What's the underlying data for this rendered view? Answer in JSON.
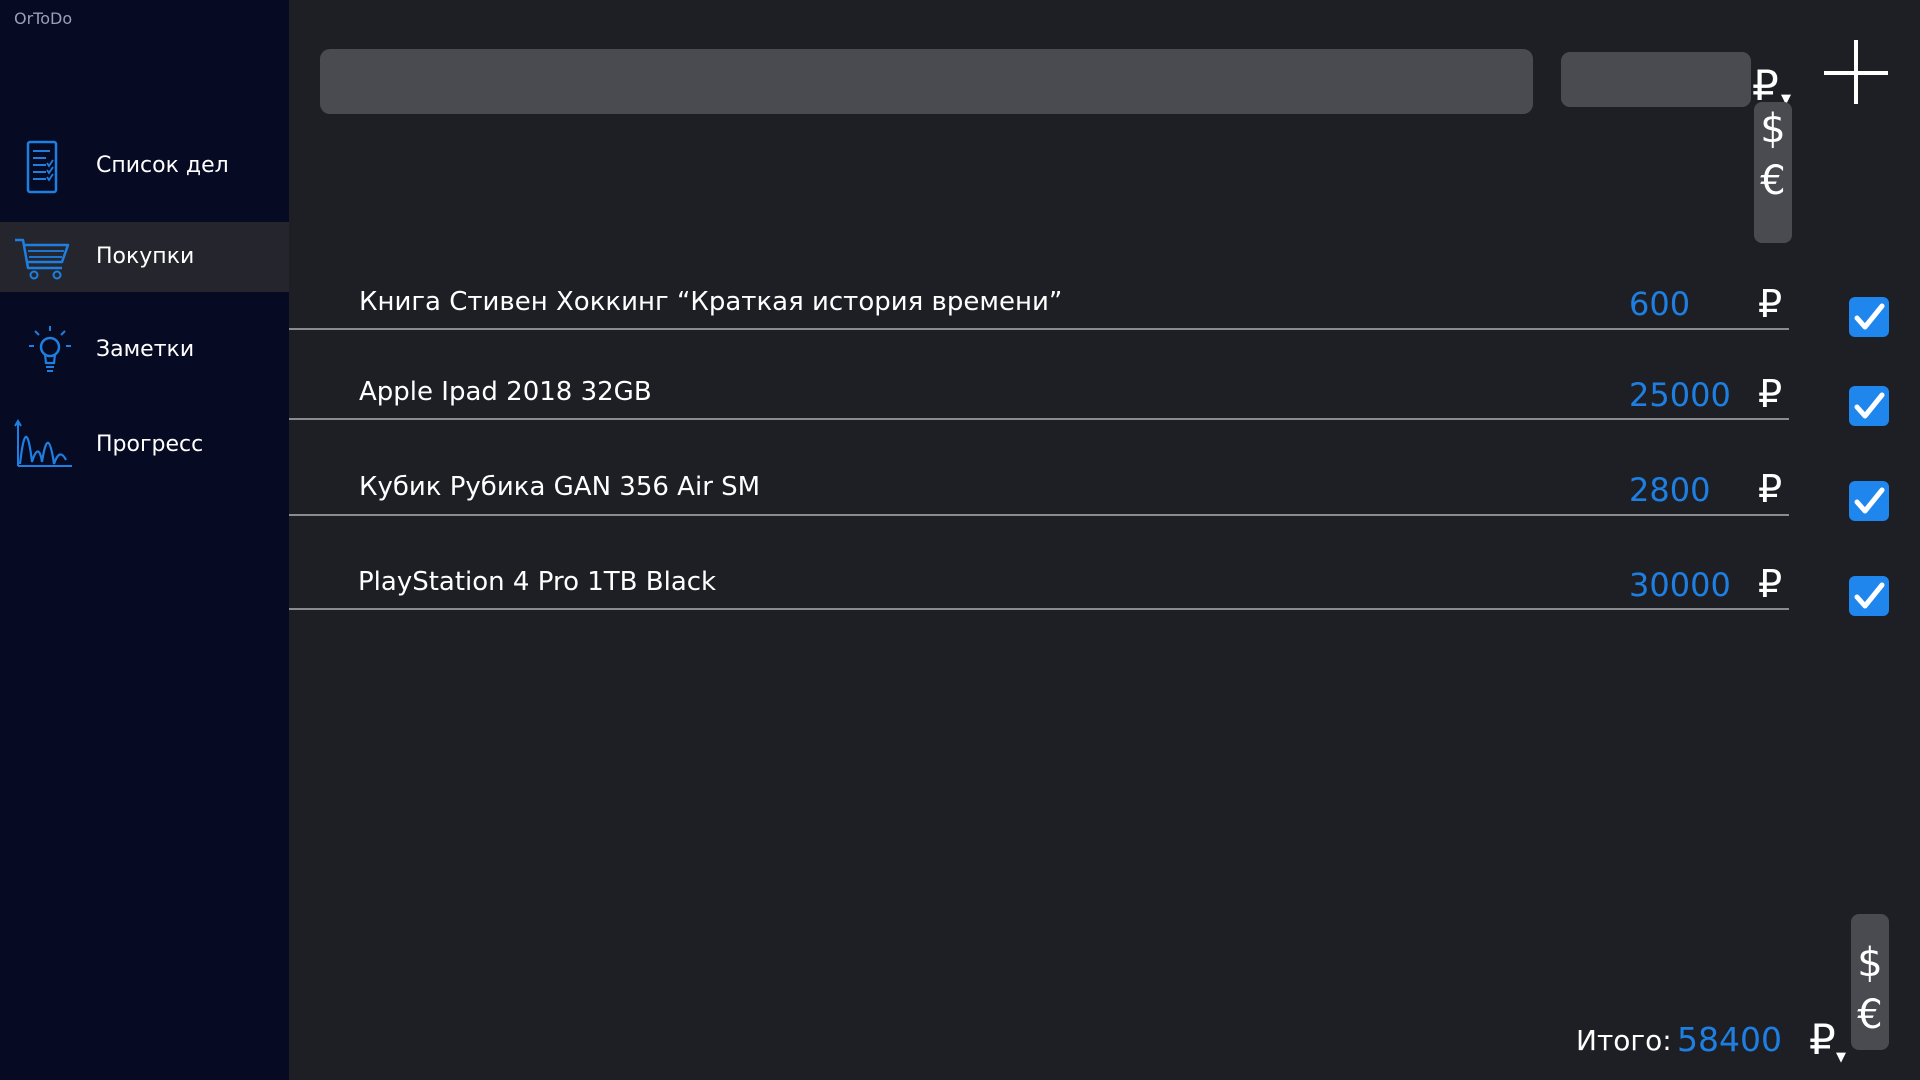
{
  "app": {
    "title": "OrToDo"
  },
  "sidebar": {
    "items": [
      {
        "label": "Список дел",
        "icon": "checklist-icon",
        "active": false
      },
      {
        "label": "Покупки",
        "icon": "cart-icon",
        "active": true
      },
      {
        "label": "Заметки",
        "icon": "lightbulb-icon",
        "active": false
      },
      {
        "label": "Прогресс",
        "icon": "chart-icon",
        "active": false
      }
    ]
  },
  "toolbar": {
    "search_value": "",
    "price_value": "",
    "currency_selected": "₽",
    "currency_options": [
      "$",
      "€"
    ],
    "add_icon": "plus-icon"
  },
  "items": [
    {
      "name": "Книга Стивен Хоккинг  “Краткая история времени”",
      "price": "600",
      "currency": "₽",
      "checked": true
    },
    {
      "name": "Apple Ipad 2018 32GB",
      "price": "25000",
      "currency": "₽",
      "checked": true
    },
    {
      "name": "Кубик Рубика GAN 356 Air SM",
      "price": "2800",
      "currency": "₽",
      "checked": true
    },
    {
      "name": "PlayStation 4 Pro 1TB Black",
      "price": "30000",
      "currency": "₽",
      "checked": true
    }
  ],
  "total": {
    "label": "Итого:",
    "value": "58400",
    "currency_selected": "₽",
    "currency_options": [
      "$",
      "€"
    ]
  },
  "colors": {
    "accent": "#1e7fe3",
    "sidebar_bg": "#060a22",
    "main_bg": "#1e1f24",
    "input_bg": "#4a4b50",
    "active_item_bg": "#25262d"
  }
}
